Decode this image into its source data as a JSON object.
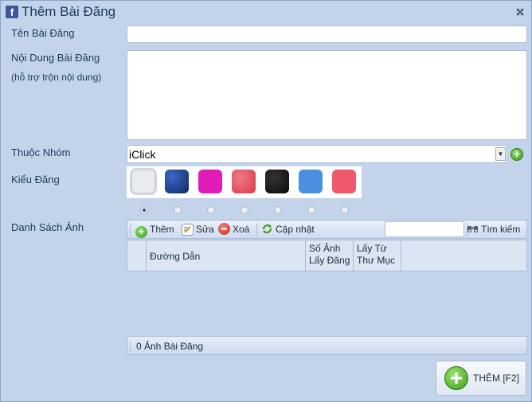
{
  "window": {
    "title": "Thêm Bài Đăng",
    "app_icon": "facebook-icon",
    "close_icon": "close-icon"
  },
  "form": {
    "title_label": "Tên Bài Đăng",
    "title_value": "",
    "content_label": "Nội Dung Bài Đăng",
    "content_hint": "(hỗ trợ trộn nội dung)",
    "content_value": "",
    "group_label": "Thuộc Nhóm",
    "group_value": "iClick",
    "style_label": "Kiểu Đăng",
    "image_list_label": "Danh Sách Ảnh"
  },
  "post_styles": {
    "swatches": [
      "#e9ebef",
      "#1c3f8e",
      "#e11bb8",
      "#e8505f",
      "#151515",
      "#4a8fe0",
      "#f0586e"
    ],
    "selected_index": 0
  },
  "toolbar": {
    "add_label": "Thêm",
    "edit_label": "Sửa",
    "delete_label": "Xoá",
    "update_label": "Cập nhật",
    "search_value": "",
    "search_label": "Tìm kiếm"
  },
  "table": {
    "columns": [
      "Đường Dẫn",
      "Số Ảnh\nLấy Đăng",
      "Lấy Từ\nThư Mục"
    ],
    "rows": []
  },
  "footer": {
    "count_text": "0 Ảnh Bài Đăng"
  },
  "actions": {
    "add_button_label": "THÊM [F2]"
  }
}
